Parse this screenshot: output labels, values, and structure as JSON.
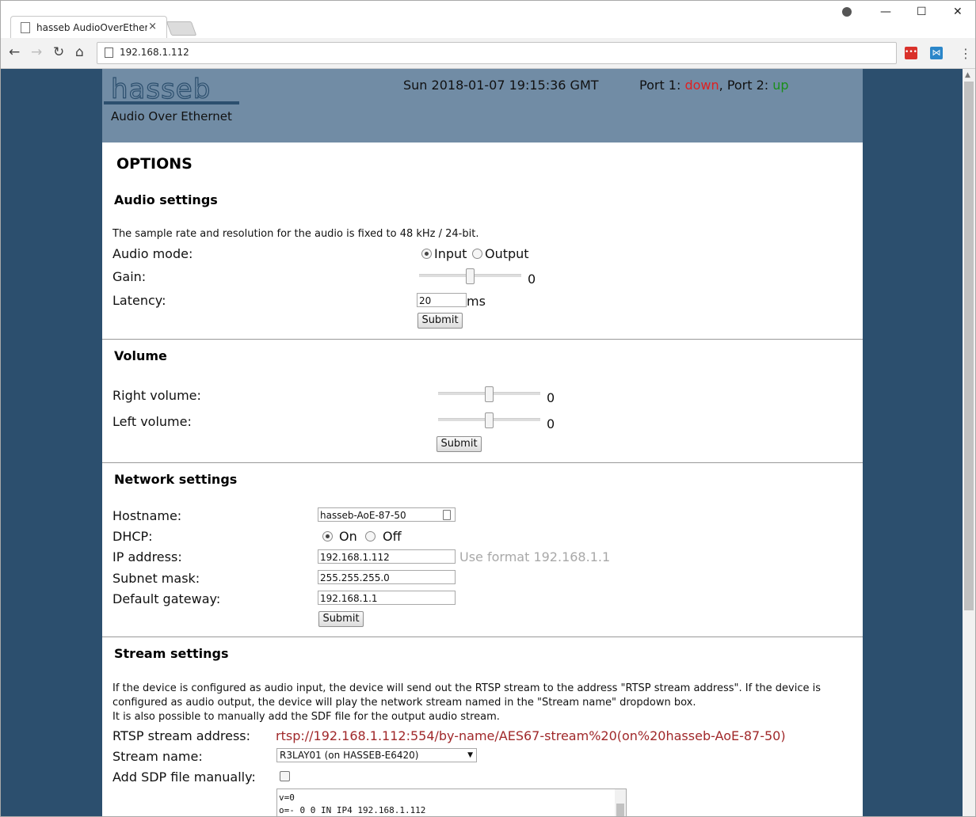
{
  "browser": {
    "tab_title": "hasseb AudioOverEthern",
    "tab_close": "×",
    "url": "192.168.1.112",
    "back": "←",
    "forward": "→",
    "reload": "↻",
    "home": "⌂",
    "minimize": "—",
    "maximize": "☐",
    "close": "✕",
    "menu": "⋮",
    "ext1_label": "•••",
    "ext2_label": "⋈",
    "scroll_up": "▲"
  },
  "header": {
    "logo": "hasseb",
    "subtitle": "Audio Over Ethernet",
    "datetime": "Sun 2018-01-07 19:15:36 GMT",
    "port1_label": "Port 1: ",
    "port1_status": "down",
    "port2_label": ", Port 2: ",
    "port2_status": "up"
  },
  "page_title": "OPTIONS",
  "audio": {
    "title": "Audio settings",
    "note": "The sample rate and resolution for the audio is fixed to 48 kHz / 24-bit.",
    "mode_label": "Audio mode:",
    "mode_input": "Input",
    "mode_output": "Output",
    "gain_label": "Gain:",
    "gain_value": "0",
    "latency_label": "Latency:",
    "latency_value": "20",
    "latency_unit": "ms",
    "submit": "Submit"
  },
  "volume": {
    "title": "Volume",
    "right_label": "Right volume:",
    "right_value": "0",
    "left_label": "Left volume:",
    "left_value": "0",
    "submit": "Submit"
  },
  "network": {
    "title": "Network settings",
    "hostname_label": "Hostname:",
    "hostname_value": "hasseb-AoE-87-50",
    "dhcp_label": "DHCP:",
    "dhcp_on": "On",
    "dhcp_off": "Off",
    "ip_label": "IP address:",
    "ip_value": "192.168.1.112",
    "ip_hint": "Use format 192.168.1.1",
    "subnet_label": "Subnet mask:",
    "subnet_value": "255.255.255.0",
    "gateway_label": "Default gateway:",
    "gateway_value": "192.168.1.1",
    "submit": "Submit"
  },
  "stream": {
    "title": "Stream settings",
    "note1": "If the device is configured as audio input, the device will send out the RTSP stream to the address \"RTSP stream address\". If the device is configured as audio output, the device will play the network stream named in the \"Stream name\" dropdown box.",
    "note2": "It is also possible to manually add the SDF file for the output audio stream.",
    "rtsp_label": "RTSP stream address:",
    "rtsp_value": "rtsp://192.168.1.112:554/by-name/AES67-stream%20(on%20hasseb-AoE-87-50)",
    "name_label": "Stream name:",
    "name_value": "R3LAY01 (on HASSEB-E6420)",
    "sdp_label": "Add SDP file manually:",
    "sdp_line1": "v=0",
    "sdp_line2": "o=- 0 0 IN IP4 192.168.1.112"
  }
}
